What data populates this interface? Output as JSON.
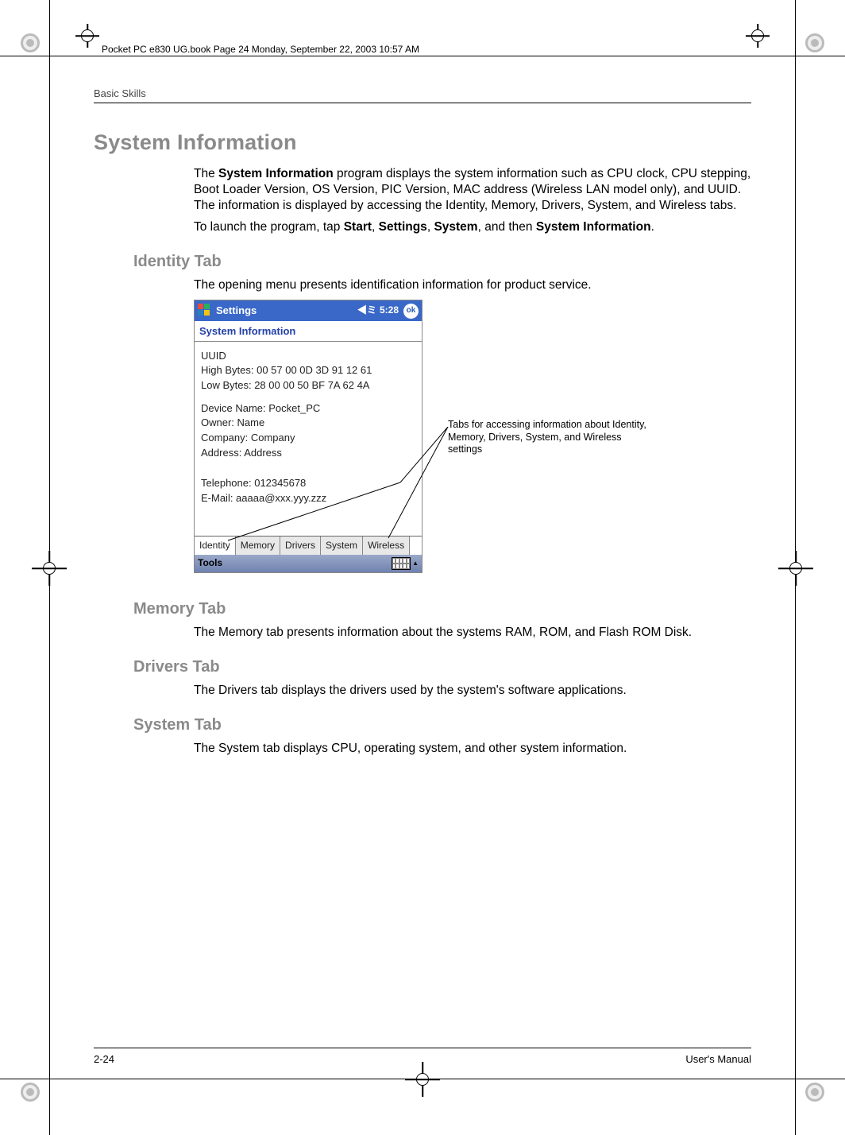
{
  "header_line": "Pocket PC e830 UG.book  Page 24  Monday, September 22, 2003  10:57 AM",
  "running_head": "Basic Skills",
  "section_title": "System Information",
  "intro_p1a": "The ",
  "intro_p1b": "System Information",
  "intro_p1c": " program displays the system information such as CPU clock, CPU stepping, Boot Loader Version, OS Version, PIC Version, MAC address (Wireless LAN model only), and UUID. The information is displayed by accessing the Identity, Memory, Drivers, System, and Wireless tabs.",
  "intro_p2a": "To launch the program, tap ",
  "intro_p2_start": "Start",
  "intro_p2_sep1": ", ",
  "intro_p2_settings": "Settings",
  "intro_p2_sep2": ", ",
  "intro_p2_system": "System",
  "intro_p2_sep3": ", and then ",
  "intro_p2_sysinfo": "System Information",
  "intro_p2_end": ".",
  "identity_head": "Identity Tab",
  "identity_text": "The opening menu presents identification information for product service.",
  "callout": "Tabs for accessing information about Identity, Memory, Drivers, System, and Wireless settings",
  "device": {
    "titlebar": "Settings",
    "time": "5:28",
    "ok": "ok",
    "app_title": "System Information",
    "uuid": "UUID",
    "high": "High Bytes: 00 57 00 0D 3D 91 12 61",
    "low": "Low Bytes: 28 00 00 50 BF 7A 62 4A",
    "dname": "Device Name: Pocket_PC",
    "owner": "Owner: Name",
    "company": "Company: Company",
    "addr": "Address: Address",
    "tel": "Telephone: 012345678",
    "email": "E-Mail:  aaaaa@xxx.yyy.zzz",
    "tabs": [
      "Identity",
      "Memory",
      "Drivers",
      "System",
      "Wireless"
    ],
    "tools": "Tools"
  },
  "memory_head": "Memory Tab",
  "memory_text": "The Memory tab presents information about the systems RAM, ROM, and Flash ROM Disk.",
  "drivers_head": "Drivers Tab",
  "drivers_text": "The Drivers tab displays the drivers used by the system's software applications.",
  "system_head": "System Tab",
  "system_text": "The System tab displays CPU, operating system, and other system information.",
  "footer_left": "2-24",
  "footer_right": "User's Manual"
}
